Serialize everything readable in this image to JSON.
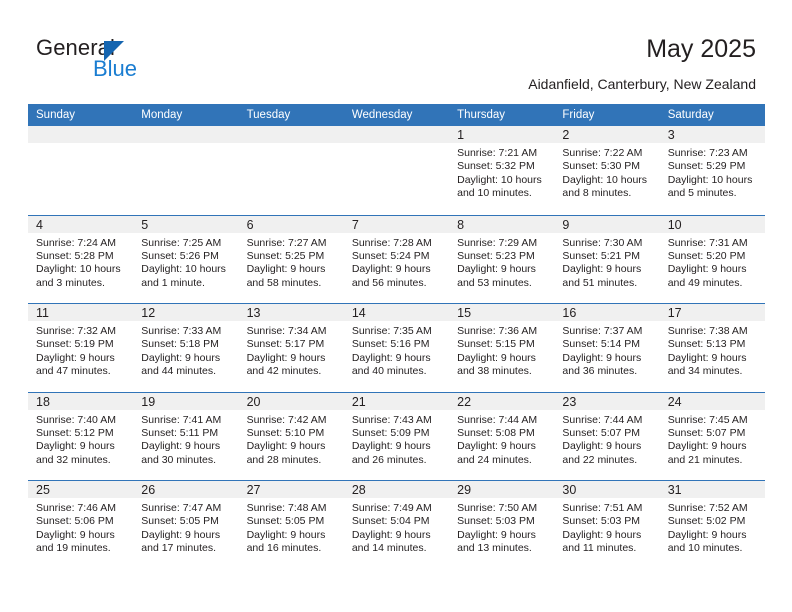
{
  "brand": {
    "name_part1": "General",
    "name_part2": "Blue",
    "triangle_color": "#1565b0",
    "blue_text_color": "#1a7dd1"
  },
  "header": {
    "title": "May 2025",
    "location": "Aidanfield, Canterbury, New Zealand"
  },
  "calendar": {
    "header_color": "#3174b8",
    "daynum_band_color": "#f0f0f0",
    "weekdays": [
      "Sunday",
      "Monday",
      "Tuesday",
      "Wednesday",
      "Thursday",
      "Friday",
      "Saturday"
    ],
    "weeks": [
      [
        {
          "day": "",
          "lines": []
        },
        {
          "day": "",
          "lines": []
        },
        {
          "day": "",
          "lines": []
        },
        {
          "day": "",
          "lines": []
        },
        {
          "day": "1",
          "lines": [
            "Sunrise: 7:21 AM",
            "Sunset: 5:32 PM",
            "Daylight: 10 hours",
            "and 10 minutes."
          ]
        },
        {
          "day": "2",
          "lines": [
            "Sunrise: 7:22 AM",
            "Sunset: 5:30 PM",
            "Daylight: 10 hours",
            "and 8 minutes."
          ]
        },
        {
          "day": "3",
          "lines": [
            "Sunrise: 7:23 AM",
            "Sunset: 5:29 PM",
            "Daylight: 10 hours",
            "and 5 minutes."
          ]
        }
      ],
      [
        {
          "day": "4",
          "lines": [
            "Sunrise: 7:24 AM",
            "Sunset: 5:28 PM",
            "Daylight: 10 hours",
            "and 3 minutes."
          ]
        },
        {
          "day": "5",
          "lines": [
            "Sunrise: 7:25 AM",
            "Sunset: 5:26 PM",
            "Daylight: 10 hours",
            "and 1 minute."
          ]
        },
        {
          "day": "6",
          "lines": [
            "Sunrise: 7:27 AM",
            "Sunset: 5:25 PM",
            "Daylight: 9 hours",
            "and 58 minutes."
          ]
        },
        {
          "day": "7",
          "lines": [
            "Sunrise: 7:28 AM",
            "Sunset: 5:24 PM",
            "Daylight: 9 hours",
            "and 56 minutes."
          ]
        },
        {
          "day": "8",
          "lines": [
            "Sunrise: 7:29 AM",
            "Sunset: 5:23 PM",
            "Daylight: 9 hours",
            "and 53 minutes."
          ]
        },
        {
          "day": "9",
          "lines": [
            "Sunrise: 7:30 AM",
            "Sunset: 5:21 PM",
            "Daylight: 9 hours",
            "and 51 minutes."
          ]
        },
        {
          "day": "10",
          "lines": [
            "Sunrise: 7:31 AM",
            "Sunset: 5:20 PM",
            "Daylight: 9 hours",
            "and 49 minutes."
          ]
        }
      ],
      [
        {
          "day": "11",
          "lines": [
            "Sunrise: 7:32 AM",
            "Sunset: 5:19 PM",
            "Daylight: 9 hours",
            "and 47 minutes."
          ]
        },
        {
          "day": "12",
          "lines": [
            "Sunrise: 7:33 AM",
            "Sunset: 5:18 PM",
            "Daylight: 9 hours",
            "and 44 minutes."
          ]
        },
        {
          "day": "13",
          "lines": [
            "Sunrise: 7:34 AM",
            "Sunset: 5:17 PM",
            "Daylight: 9 hours",
            "and 42 minutes."
          ]
        },
        {
          "day": "14",
          "lines": [
            "Sunrise: 7:35 AM",
            "Sunset: 5:16 PM",
            "Daylight: 9 hours",
            "and 40 minutes."
          ]
        },
        {
          "day": "15",
          "lines": [
            "Sunrise: 7:36 AM",
            "Sunset: 5:15 PM",
            "Daylight: 9 hours",
            "and 38 minutes."
          ]
        },
        {
          "day": "16",
          "lines": [
            "Sunrise: 7:37 AM",
            "Sunset: 5:14 PM",
            "Daylight: 9 hours",
            "and 36 minutes."
          ]
        },
        {
          "day": "17",
          "lines": [
            "Sunrise: 7:38 AM",
            "Sunset: 5:13 PM",
            "Daylight: 9 hours",
            "and 34 minutes."
          ]
        }
      ],
      [
        {
          "day": "18",
          "lines": [
            "Sunrise: 7:40 AM",
            "Sunset: 5:12 PM",
            "Daylight: 9 hours",
            "and 32 minutes."
          ]
        },
        {
          "day": "19",
          "lines": [
            "Sunrise: 7:41 AM",
            "Sunset: 5:11 PM",
            "Daylight: 9 hours",
            "and 30 minutes."
          ]
        },
        {
          "day": "20",
          "lines": [
            "Sunrise: 7:42 AM",
            "Sunset: 5:10 PM",
            "Daylight: 9 hours",
            "and 28 minutes."
          ]
        },
        {
          "day": "21",
          "lines": [
            "Sunrise: 7:43 AM",
            "Sunset: 5:09 PM",
            "Daylight: 9 hours",
            "and 26 minutes."
          ]
        },
        {
          "day": "22",
          "lines": [
            "Sunrise: 7:44 AM",
            "Sunset: 5:08 PM",
            "Daylight: 9 hours",
            "and 24 minutes."
          ]
        },
        {
          "day": "23",
          "lines": [
            "Sunrise: 7:44 AM",
            "Sunset: 5:07 PM",
            "Daylight: 9 hours",
            "and 22 minutes."
          ]
        },
        {
          "day": "24",
          "lines": [
            "Sunrise: 7:45 AM",
            "Sunset: 5:07 PM",
            "Daylight: 9 hours",
            "and 21 minutes."
          ]
        }
      ],
      [
        {
          "day": "25",
          "lines": [
            "Sunrise: 7:46 AM",
            "Sunset: 5:06 PM",
            "Daylight: 9 hours",
            "and 19 minutes."
          ]
        },
        {
          "day": "26",
          "lines": [
            "Sunrise: 7:47 AM",
            "Sunset: 5:05 PM",
            "Daylight: 9 hours",
            "and 17 minutes."
          ]
        },
        {
          "day": "27",
          "lines": [
            "Sunrise: 7:48 AM",
            "Sunset: 5:05 PM",
            "Daylight: 9 hours",
            "and 16 minutes."
          ]
        },
        {
          "day": "28",
          "lines": [
            "Sunrise: 7:49 AM",
            "Sunset: 5:04 PM",
            "Daylight: 9 hours",
            "and 14 minutes."
          ]
        },
        {
          "day": "29",
          "lines": [
            "Sunrise: 7:50 AM",
            "Sunset: 5:03 PM",
            "Daylight: 9 hours",
            "and 13 minutes."
          ]
        },
        {
          "day": "30",
          "lines": [
            "Sunrise: 7:51 AM",
            "Sunset: 5:03 PM",
            "Daylight: 9 hours",
            "and 11 minutes."
          ]
        },
        {
          "day": "31",
          "lines": [
            "Sunrise: 7:52 AM",
            "Sunset: 5:02 PM",
            "Daylight: 9 hours",
            "and 10 minutes."
          ]
        }
      ]
    ]
  }
}
